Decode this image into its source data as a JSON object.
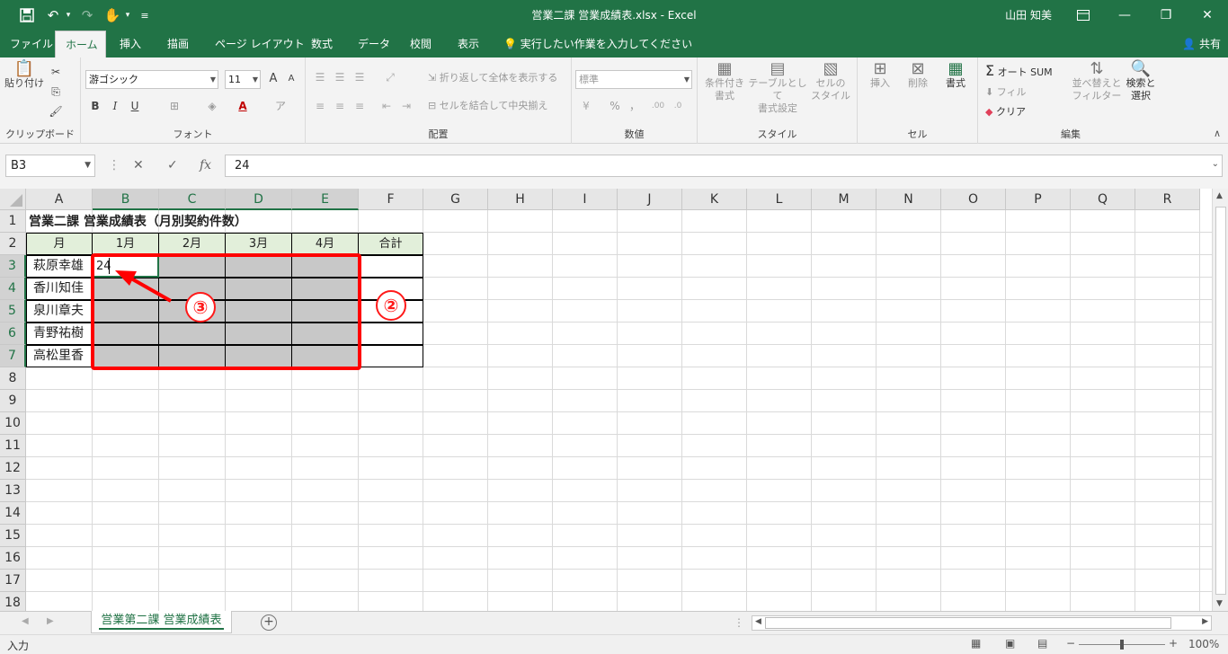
{
  "quick_access": [
    "save-icon",
    "undo-icon",
    "redo-icon",
    "touch-mode-icon",
    "customize-icon"
  ],
  "window": {
    "title": "営業二課 営業成績表.xlsx  -  Excel",
    "user": "山田 知美",
    "ribbon_display": "ribbon-display-icon",
    "minimize": "—",
    "maximize": "❐",
    "close": "✕"
  },
  "tabs": [
    "ファイル",
    "ホーム",
    "挿入",
    "描画",
    "ページ レイアウト",
    "数式",
    "データ",
    "校閲",
    "表示"
  ],
  "active_tab": "ホーム",
  "tell_me": "実行したい作業を入力してください",
  "share": "共有",
  "ribbon": {
    "clipboard": {
      "label": "クリップボード",
      "paste": "貼り付け"
    },
    "font": {
      "label": "フォント",
      "name": "游ゴシック",
      "size": "11",
      "bold": "B",
      "italic": "I",
      "underline": "U",
      "grow": "A",
      "shrink": "A"
    },
    "alignment": {
      "label": "配置",
      "wrap": "折り返して全体を表示する",
      "merge": "セルを結合して中央揃え"
    },
    "number": {
      "label": "数値",
      "format": "標準",
      "percent": "%",
      "comma": "，"
    },
    "styles": {
      "label": "スタイル",
      "conditional": [
        "条件付き",
        "書式"
      ],
      "table": [
        "テーブルとして",
        "書式設定"
      ],
      "cell": [
        "セルの",
        "スタイル"
      ]
    },
    "cells": {
      "label": "セル",
      "insert": "挿入",
      "delete": "削除",
      "format": "書式"
    },
    "editing": {
      "label": "編集",
      "autosum": "オート SUM",
      "fill": "フィル",
      "clear": "クリア",
      "sort": [
        "並べ替えと",
        "フィルター"
      ],
      "find": [
        "検索と",
        "選択"
      ]
    }
  },
  "formula_bar": {
    "name_box": "B3",
    "cancel": "✕",
    "enter": "✓",
    "fx": "fx",
    "value": "24"
  },
  "columns": [
    "A",
    "B",
    "C",
    "D",
    "E",
    "F",
    "G",
    "H",
    "I",
    "J",
    "K",
    "L",
    "M",
    "N",
    "O",
    "P",
    "Q",
    "R"
  ],
  "rows": [
    "1",
    "2",
    "3",
    "4",
    "5",
    "6",
    "7",
    "8",
    "9",
    "10",
    "11",
    "12",
    "13",
    "14",
    "15",
    "16",
    "17",
    "18"
  ],
  "sheet": {
    "title": "営業二課 営業成績表（月別契約件数）",
    "header": [
      "月",
      "1月",
      "2月",
      "3月",
      "4月",
      "合計"
    ],
    "names": [
      "萩原幸雄",
      "香川知佳",
      "泉川章夫",
      "青野祐樹",
      "高松里香"
    ],
    "active_value": "24"
  },
  "annotations": {
    "circle_2": "②",
    "circle_3": "③"
  },
  "sheet_tab": "営業第二課 営業成績表",
  "add_sheet": "+",
  "status": {
    "mode": "入力",
    "zoom": "100%",
    "zoom_minus": "−",
    "zoom_plus": "+"
  },
  "colors": {
    "excel_green": "#217346",
    "header_fill": "#e2efda",
    "selection_fill": "#c8c8c8",
    "annotation_red": "#ff0000"
  }
}
